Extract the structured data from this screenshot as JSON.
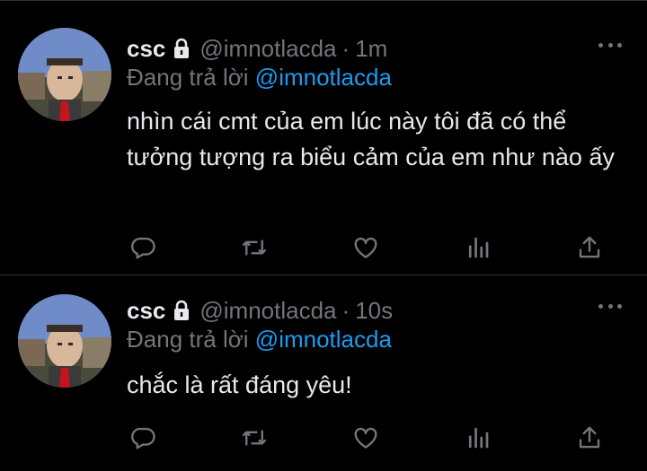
{
  "colors": {
    "background": "#000000",
    "primary_text": "#e7e9ea",
    "secondary_text": "#71767b",
    "mention": "#1d9bf0",
    "divider": "#2f3336"
  },
  "tweets": [
    {
      "display_name": "csc",
      "protected_icon": "lock-icon",
      "handle": "@imnotlacda",
      "separator": "·",
      "time": "1m",
      "replying_prefix": "Đang trả lời",
      "replying_to": "@imnotlacda",
      "text": "nhìn cái cmt của em lúc này tôi đã có thể tưởng tượng ra biểu cảm của em như nào ấy",
      "actions": [
        "reply-icon",
        "retweet-icon",
        "like-icon",
        "stats-icon",
        "share-icon"
      ]
    },
    {
      "display_name": "csc",
      "protected_icon": "lock-icon",
      "handle": "@imnotlacda",
      "separator": "·",
      "time": "10s",
      "replying_prefix": "Đang trả lời",
      "replying_to": "@imnotlacda",
      "text": "chắc là rất đáng yêu!",
      "actions": [
        "reply-icon",
        "retweet-icon",
        "like-icon",
        "stats-icon",
        "share-icon"
      ]
    }
  ]
}
